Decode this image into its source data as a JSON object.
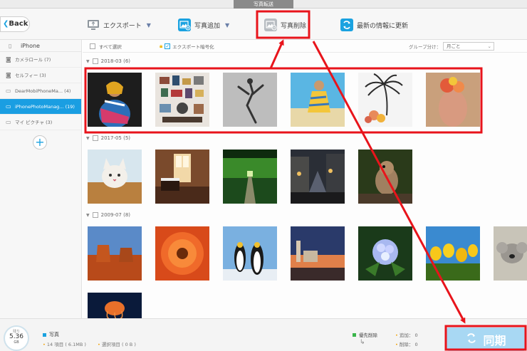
{
  "window": {
    "title": "写真転送"
  },
  "toolbar": {
    "back_label": "Back",
    "export_label": "エクスポート",
    "add_label": "写真追加",
    "delete_label": "写真削除",
    "refresh_label": "最新の情報に更新"
  },
  "sidebar": {
    "device": "iPhone",
    "items": [
      {
        "label": "カメラロール (7)"
      },
      {
        "label": "セルフィー (3)"
      },
      {
        "label": "DearMobiPhoneMa... (4)"
      },
      {
        "label": "iPhonePhotoManag... (19)"
      },
      {
        "label": "マイ ピクチャ (3)"
      }
    ]
  },
  "filter": {
    "select_all": "すべて選択",
    "encrypt": "エクスポート暗号化",
    "group_by_label": "グループ分け：",
    "group_by_value": "月ごと"
  },
  "groups": [
    {
      "label": "2018-03 (6)"
    },
    {
      "label": "2017-05 (5)"
    },
    {
      "label": "2009-07 (8)"
    }
  ],
  "status": {
    "storage_label": "残り",
    "storage_value": "5.36",
    "storage_unit": "GB",
    "photos_label": "写真",
    "count_text": "14 項目 ( 6.1MB )",
    "selected_text": "選択項目 ( 0 B )",
    "pending_delete": "優先削除",
    "added_text": "追加： 0",
    "deleted_text": "削除： 0",
    "sync_label": "同期"
  },
  "colors": {
    "accent": "#1a9ee2",
    "highlight": "#e8141b",
    "sync_bg": "#a8d8f3"
  }
}
